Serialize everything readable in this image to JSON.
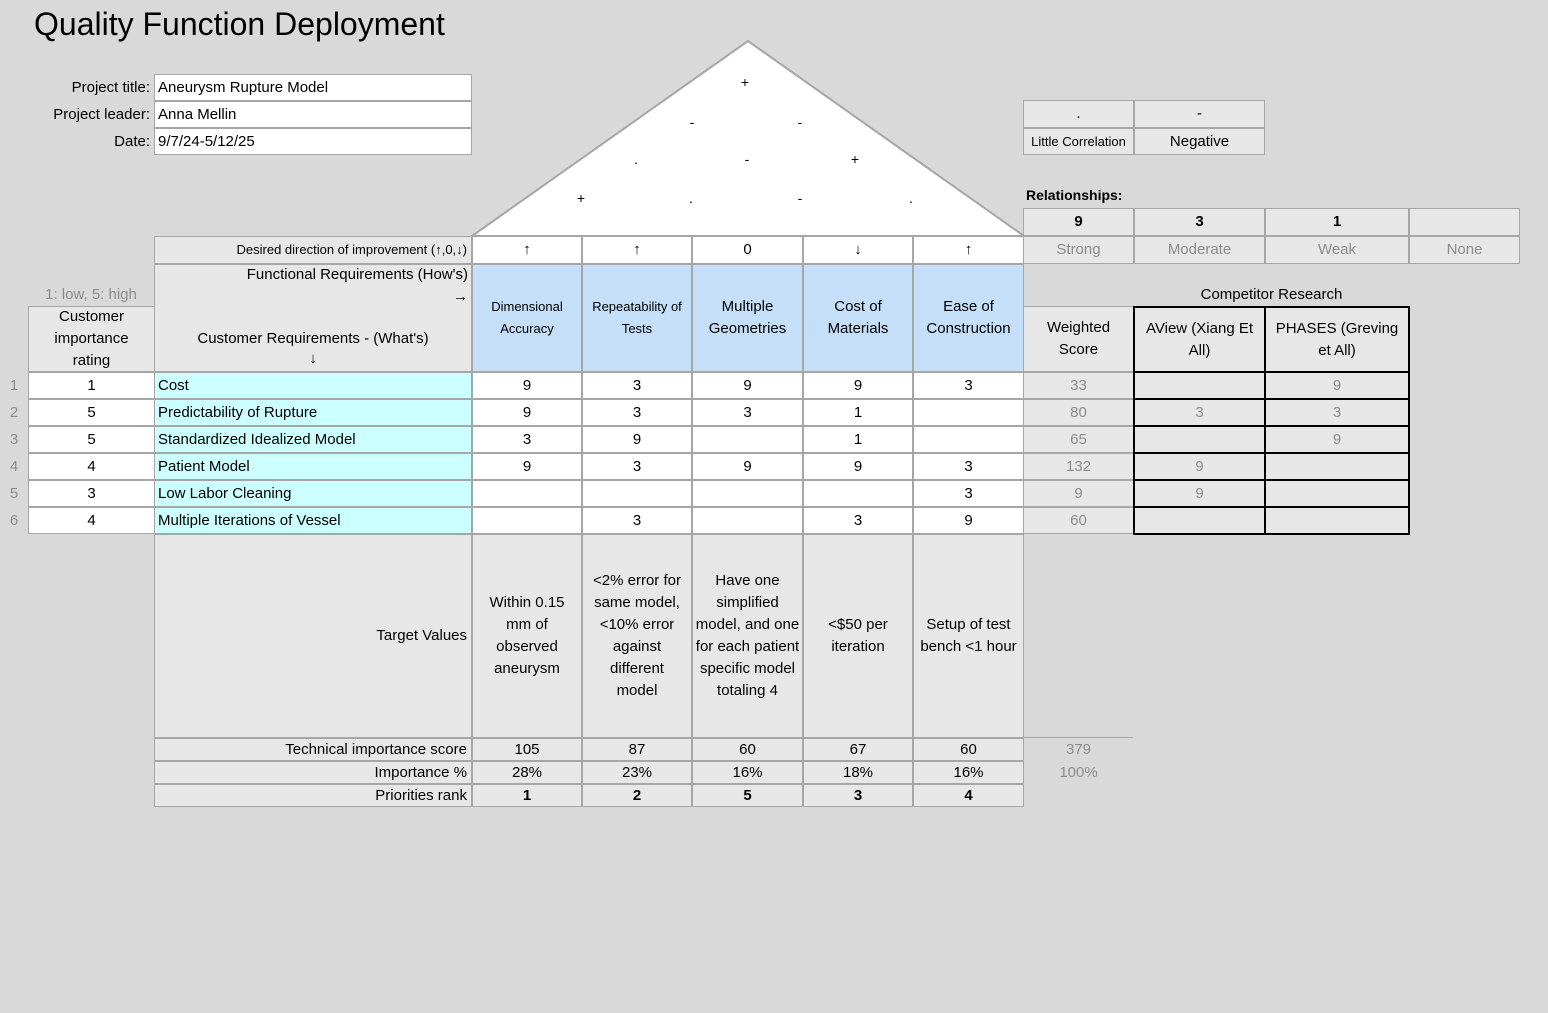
{
  "title": "Quality Function Deployment",
  "project": {
    "title_label": "Project title:",
    "title_value": "Aneurysm Rupture Model",
    "leader_label": "Project leader:",
    "leader_value": "Anna Mellin",
    "date_label": "Date:",
    "date_value": "9/7/24-5/12/25"
  },
  "roof": [
    "+",
    "-",
    "-",
    ".",
    "-",
    "+",
    "+",
    ".",
    "-",
    "."
  ],
  "legend_corr": {
    "symbols": [
      ".",
      "-"
    ],
    "labels": [
      "Little Correlation",
      "Negative"
    ]
  },
  "relationships": {
    "label": "Relationships:",
    "values": [
      "9",
      "3",
      "1",
      ""
    ],
    "labels": [
      "Strong",
      "Moderate",
      "Weak",
      "None"
    ]
  },
  "direction": {
    "label": "Desired direction of improvement (↑,0,↓)",
    "values": [
      "↑",
      "↑",
      "0",
      "↓",
      "↑"
    ]
  },
  "headers": {
    "functional": "Functional Requirements (How's)",
    "functional_arrow": "→",
    "scale": "1: low, 5: high",
    "importance": "Customer importance rating",
    "customer": "Customer Requirements - (What's)",
    "customer_arrow": "↓",
    "weighted": "Weighted Score",
    "competitor": "Competitor Research"
  },
  "functional_requirements": [
    "Dimensional Accuracy",
    "Repeatability of Tests",
    "Multiple Geometries",
    "Cost of Materials",
    "Ease of Construction"
  ],
  "competitors": [
    "AView (Xiang Et All)",
    "PHASES (Greving et All)"
  ],
  "rows": [
    {
      "num": "1",
      "importance": "1",
      "name": "Cost",
      "rel": [
        "9",
        "3",
        "9",
        "9",
        "3"
      ],
      "score": "33",
      "comp": [
        "",
        "9"
      ]
    },
    {
      "num": "2",
      "importance": "5",
      "name": "Predictability of Rupture",
      "rel": [
        "9",
        "3",
        "3",
        "1",
        ""
      ],
      "score": "80",
      "comp": [
        "3",
        "3"
      ]
    },
    {
      "num": "3",
      "importance": "5",
      "name": "Standardized Idealized Model",
      "rel": [
        "3",
        "9",
        "",
        "1",
        ""
      ],
      "score": "65",
      "comp": [
        "",
        "9"
      ]
    },
    {
      "num": "4",
      "importance": "4",
      "name": "Patient Model",
      "rel": [
        "9",
        "3",
        "9",
        "9",
        "3"
      ],
      "score": "132",
      "comp": [
        "9",
        ""
      ]
    },
    {
      "num": "5",
      "importance": "3",
      "name": "Low Labor Cleaning",
      "rel": [
        "",
        "",
        "",
        "",
        "3"
      ],
      "score": "9",
      "comp": [
        "9",
        ""
      ]
    },
    {
      "num": "6",
      "importance": "4",
      "name": "Multiple Iterations of Vessel",
      "rel": [
        "",
        "3",
        "",
        "3",
        "9"
      ],
      "score": "60",
      "comp": [
        "",
        ""
      ]
    }
  ],
  "target": {
    "label": "Target Values",
    "values": [
      "Within 0.15 mm of observed aneurysm",
      "<2% error for same model, <10% error against different model",
      "Have one simplified model, and one for each patient specific model totaling 4",
      "<$50 per iteration",
      "Setup of test bench <1 hour"
    ]
  },
  "technical": {
    "label": "Technical importance score",
    "values": [
      "105",
      "87",
      "60",
      "67",
      "60"
    ],
    "total": "379"
  },
  "importance_pct": {
    "label": "Importance %",
    "values": [
      "28%",
      "23%",
      "16%",
      "18%",
      "16%"
    ],
    "total": "100%"
  },
  "rank": {
    "label": "Priorities rank",
    "values": [
      "1",
      "2",
      "5",
      "3",
      "4"
    ]
  }
}
